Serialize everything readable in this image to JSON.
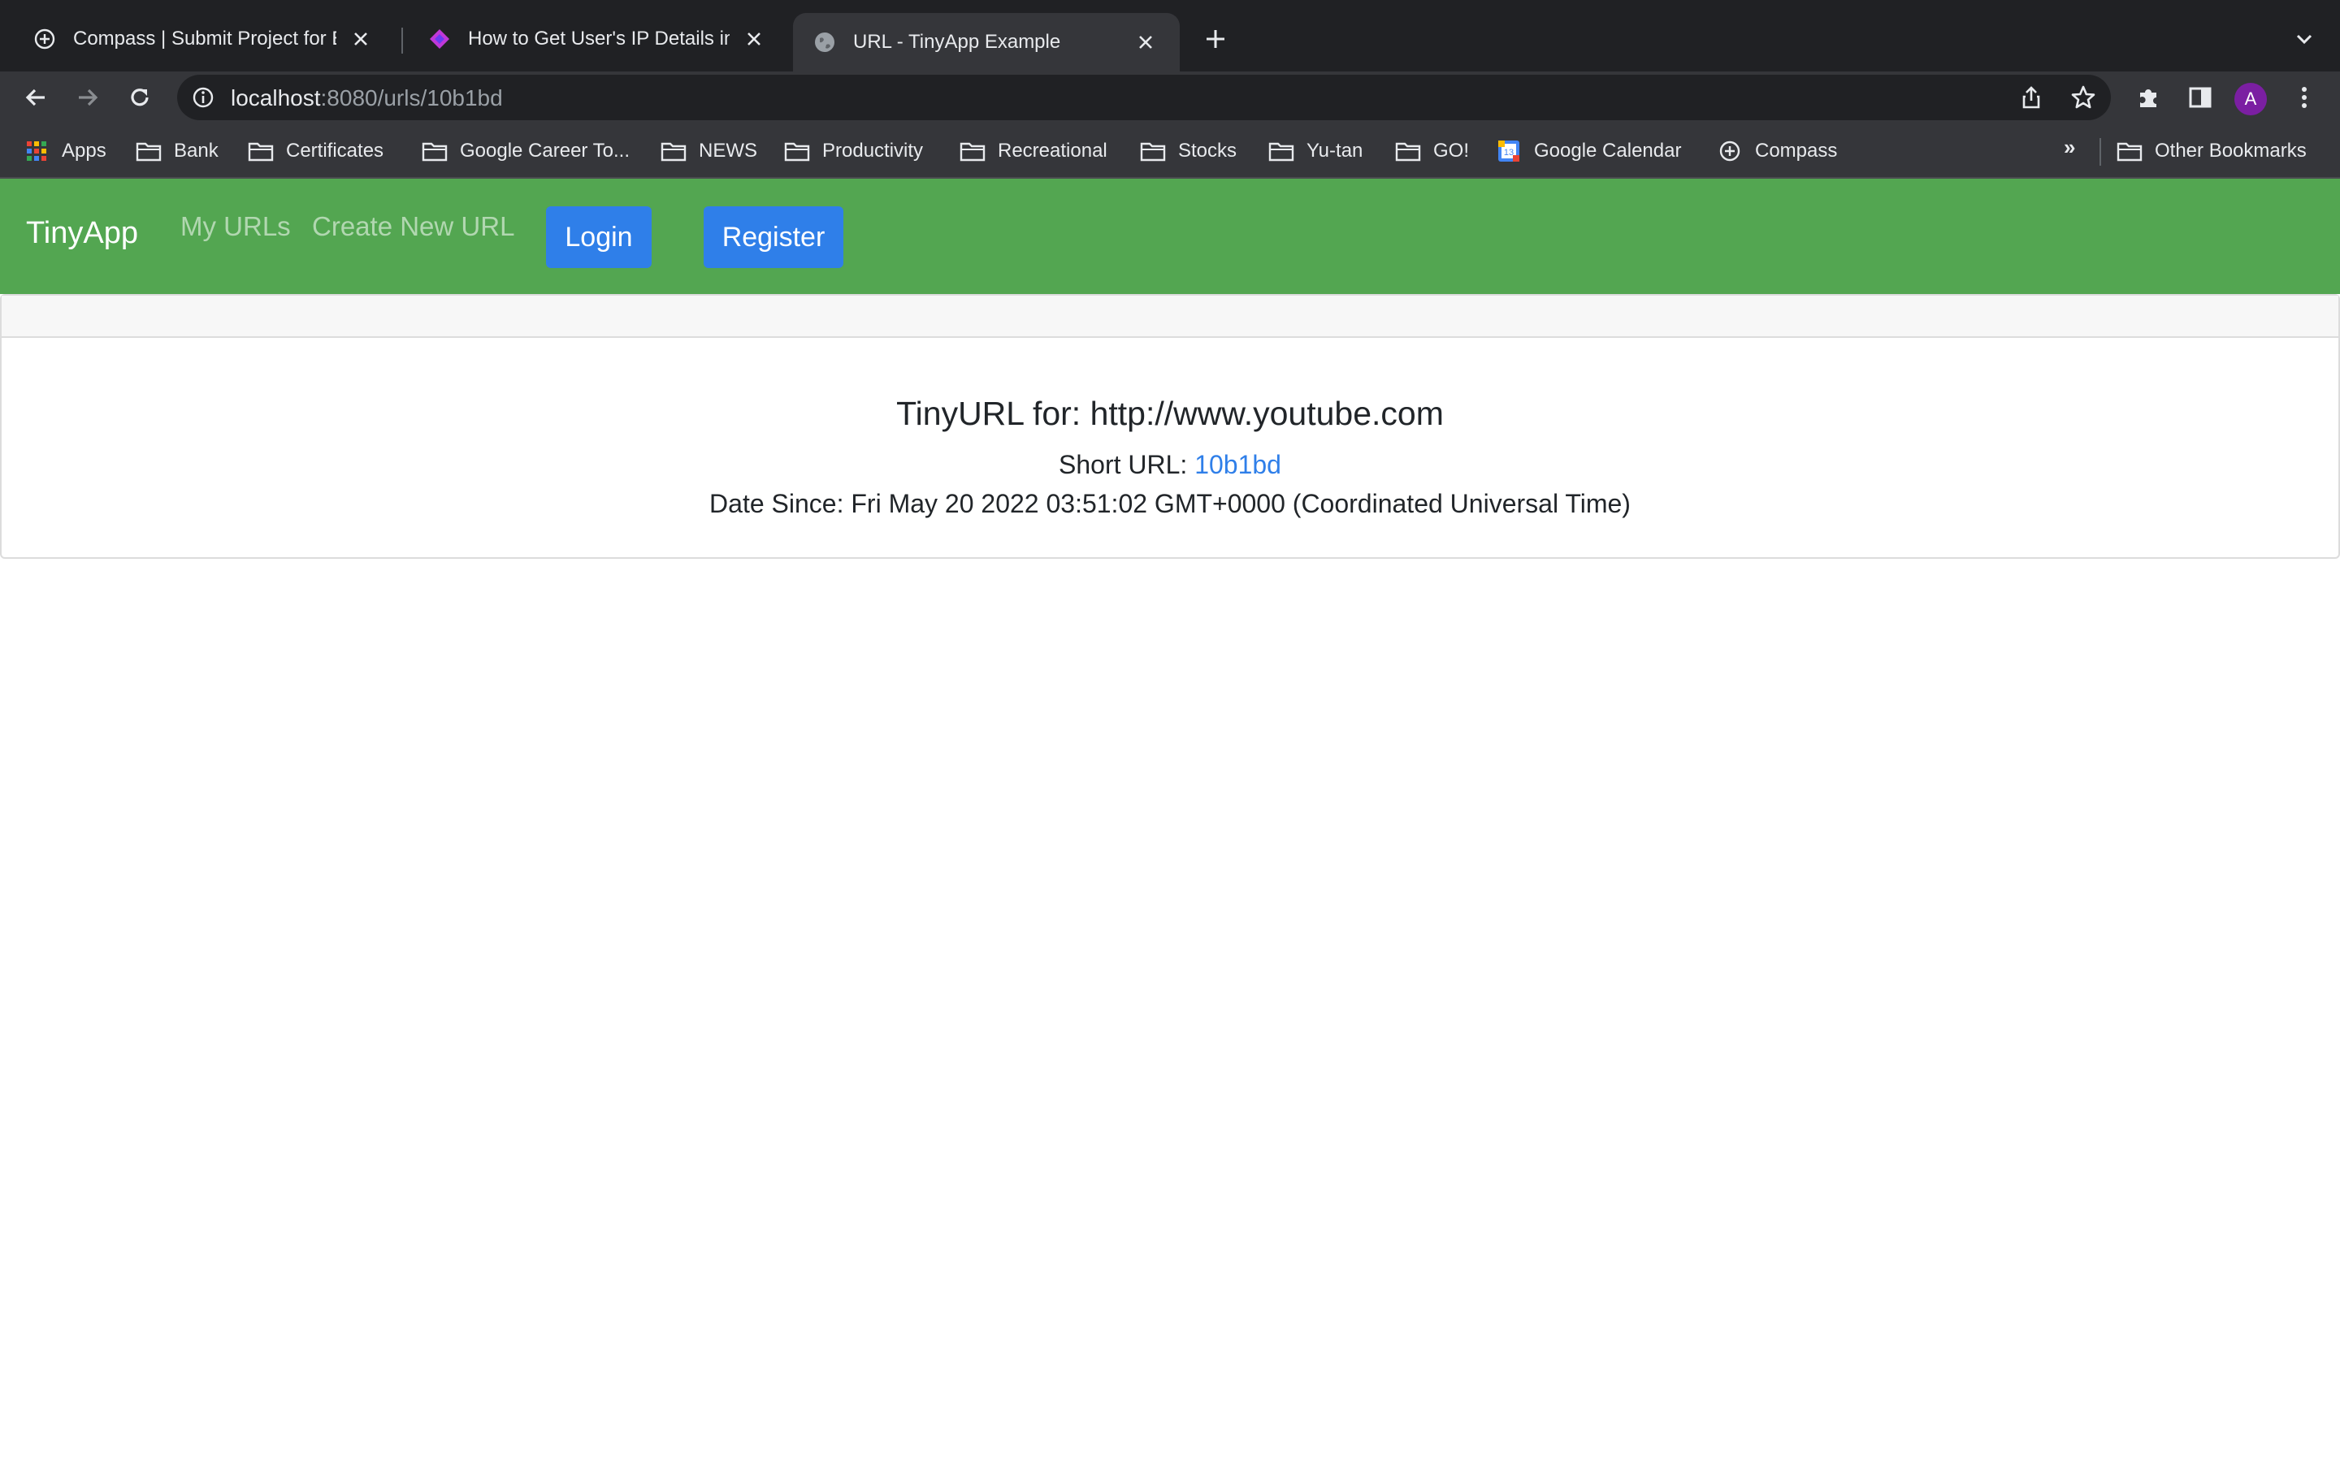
{
  "browser": {
    "tabs": [
      {
        "title": "Compass | Submit Project for E",
        "favicon": "compass-icon",
        "active": false
      },
      {
        "title": "How to Get User's IP Details in",
        "favicon": "dev-icon",
        "active": false
      },
      {
        "title": "URL - TinyApp Example",
        "favicon": "globe-icon",
        "active": true
      }
    ],
    "address_bar": {
      "host": "localhost",
      "path": ":8080/urls/10b1bd"
    },
    "profile_initial": "A",
    "bookmarks": [
      {
        "label": "Apps",
        "icon": "apps-grid-icon"
      },
      {
        "label": "Bank",
        "icon": "folder-icon"
      },
      {
        "label": "Certificates",
        "icon": "folder-icon"
      },
      {
        "label": "Google Career To...",
        "icon": "folder-icon"
      },
      {
        "label": "NEWS",
        "icon": "folder-icon"
      },
      {
        "label": "Productivity",
        "icon": "folder-icon"
      },
      {
        "label": "Recreational",
        "icon": "folder-icon"
      },
      {
        "label": "Stocks",
        "icon": "folder-icon"
      },
      {
        "label": "Yu-tan",
        "icon": "folder-icon"
      },
      {
        "label": "GO!",
        "icon": "folder-icon"
      },
      {
        "label": "Google Calendar",
        "icon": "calendar-icon"
      },
      {
        "label": "Compass",
        "icon": "compass-icon"
      }
    ],
    "more_bookmarks": "»",
    "other_bookmarks": "Other Bookmarks"
  },
  "app": {
    "brand": "TinyApp",
    "nav": {
      "my_urls": "My URLs",
      "create_new_url": "Create New URL",
      "login": "Login",
      "register": "Register"
    },
    "colors": {
      "navbar": "#53a651",
      "button": "#2f7fe9",
      "link": "#2f7fe9"
    }
  },
  "url_card": {
    "title": "TinyURL for: http://www.youtube.com",
    "short_url_label": "Short URL: ",
    "short_url": "10b1bd",
    "date_label": "Date Since: ",
    "date_value": "Fri May 20 2022 03:51:02 GMT+0000 (Coordinated Universal Time)"
  }
}
